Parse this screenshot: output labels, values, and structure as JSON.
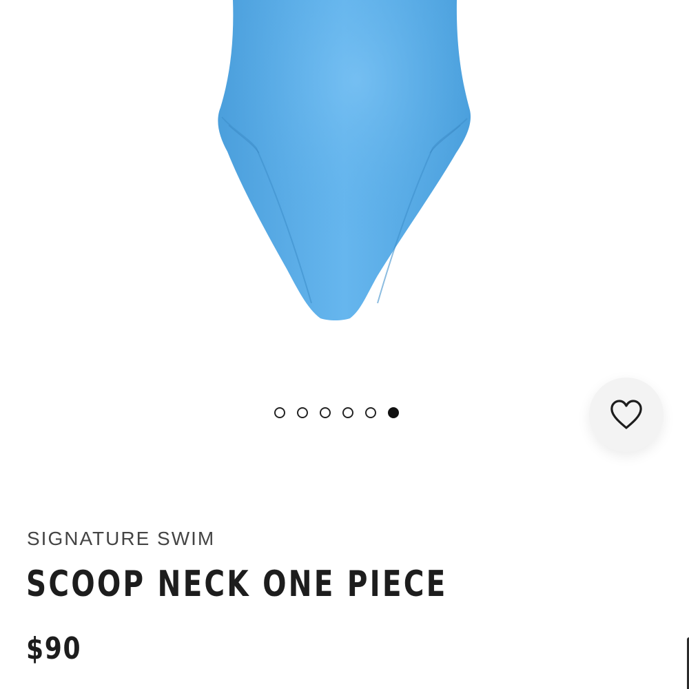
{
  "product": {
    "collection": "SIGNATURE SWIM",
    "title": "SCOOP NECK ONE PIECE",
    "price": "$90",
    "color": "#5AAEE8"
  },
  "gallery": {
    "total_images": 6,
    "active_index": 6
  },
  "favorite": {
    "icon": "heart-outline-icon"
  }
}
